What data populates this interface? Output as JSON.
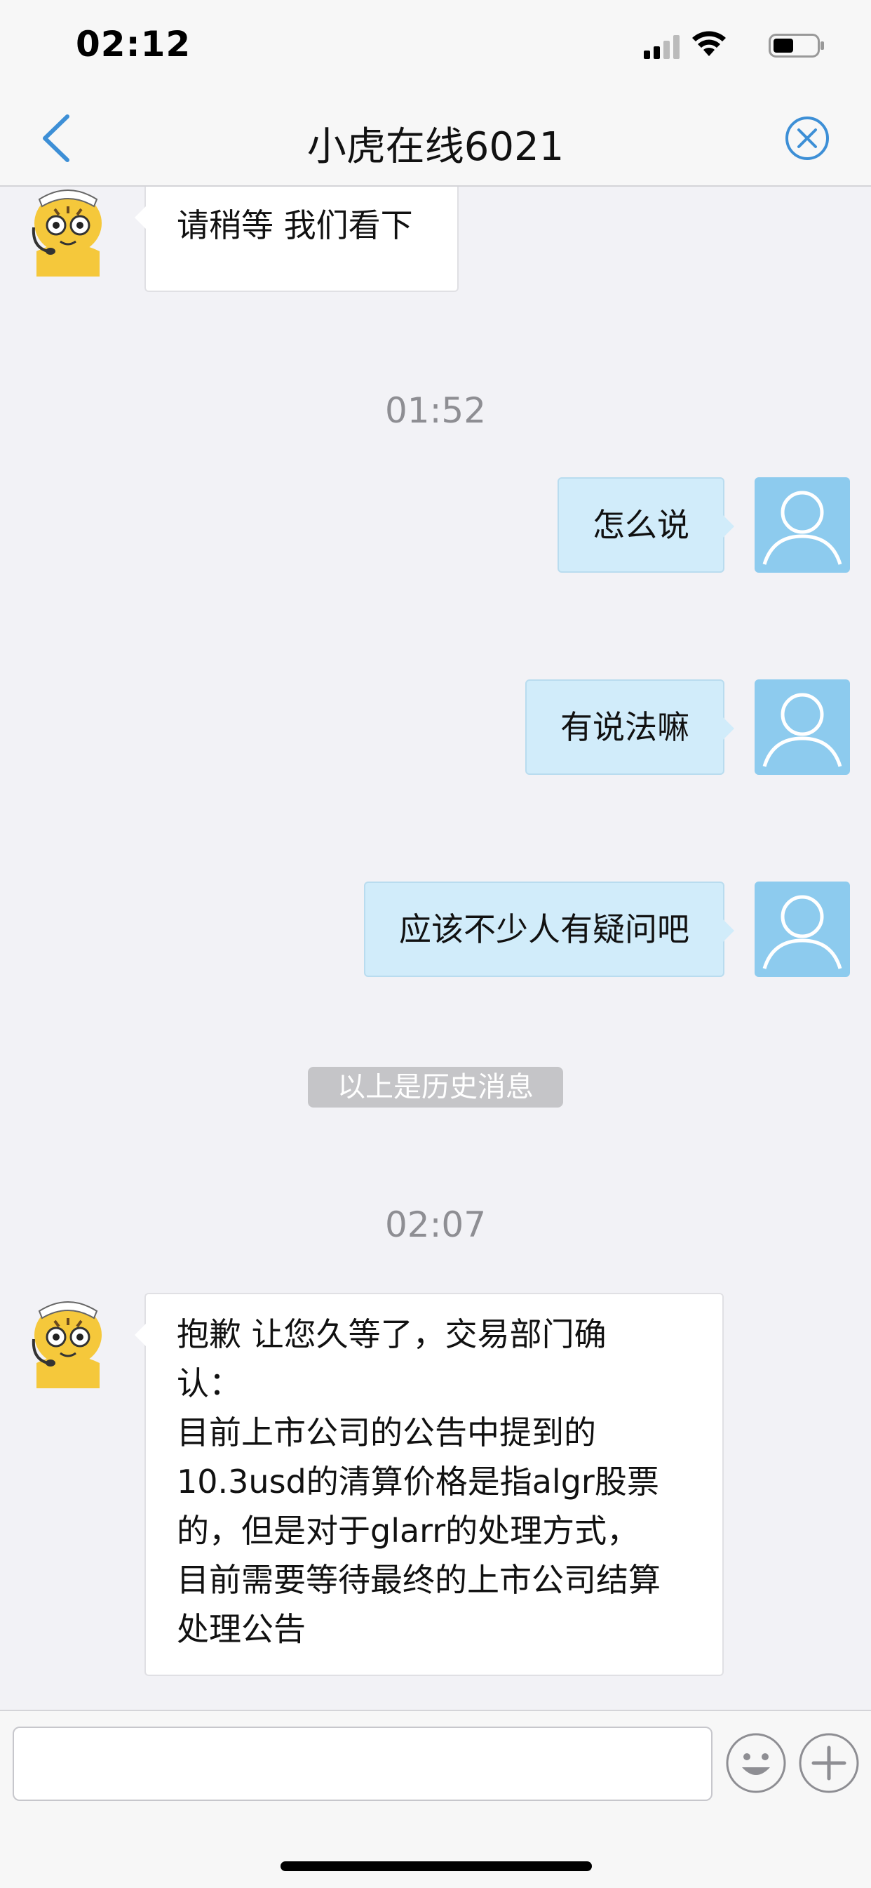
{
  "status_bar": {
    "time": "02:12"
  },
  "nav": {
    "title": "小虎在线6021",
    "back_icon": "chevron-left-icon",
    "close_icon": "close-circle-icon"
  },
  "messages": [
    {
      "sender": "agent",
      "text": "请稍等 我们看下"
    },
    {
      "type": "timestamp",
      "text": "01:52"
    },
    {
      "sender": "user",
      "text": "怎么说"
    },
    {
      "sender": "user",
      "text": "有说法嘛"
    },
    {
      "sender": "user",
      "text": "应该不少人有疑问吧"
    },
    {
      "type": "divider",
      "text": "以上是历史消息"
    },
    {
      "type": "timestamp",
      "text": "02:07"
    },
    {
      "sender": "agent",
      "lines": [
        "抱歉 让您久等了，交易部门确",
        "认：",
        "目前上市公司的公告中提到的",
        "10.3usd的清算价格是指algr股票",
        "的，但是对于glarr的处理方式，",
        "目前需要等待最终的上市公司结算",
        "处理公告"
      ]
    }
  ],
  "input_bar": {
    "value": "",
    "placeholder": "",
    "emoji_icon": "smiley-face-icon",
    "plus_icon": "plus-circle-icon"
  },
  "colors": {
    "accent": "#3d8fd6",
    "user_bubble": "#d1ecfa",
    "user_avatar": "#8dcbee",
    "background": "#f2f2f6"
  }
}
